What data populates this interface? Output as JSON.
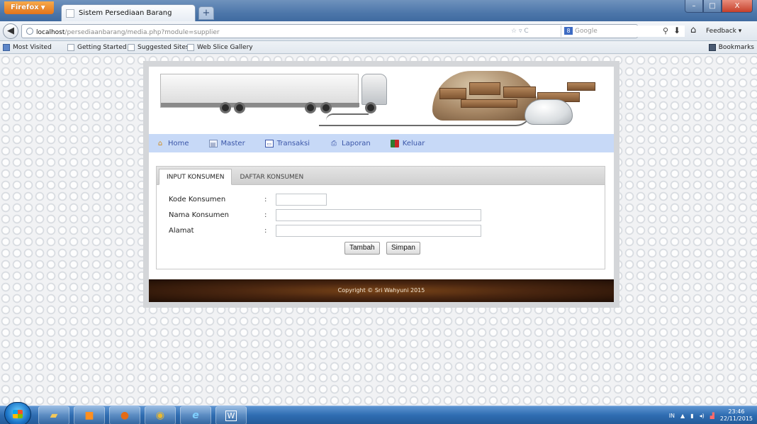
{
  "browser": {
    "app_button": "Firefox",
    "tab_title": "Sistem Persediaan Barang",
    "new_tab": "+",
    "url_host": "localhost",
    "url_path": "/persediaanbarang/media.php?module=supplier",
    "search_placeholder": "Google",
    "feedback_label": "Feedback",
    "window_controls": {
      "minimize": "–",
      "maximize": "□",
      "close": "X"
    }
  },
  "bookmarks": {
    "items": [
      "Most Visited",
      "Getting Started",
      "Suggested Sites",
      "Web Slice Gallery"
    ],
    "bookmarks_label": "Bookmarks"
  },
  "menu": {
    "items": [
      {
        "label": "Home",
        "icon": "home-icon"
      },
      {
        "label": "Master",
        "icon": "master-icon"
      },
      {
        "label": "Transaksi",
        "icon": "transaksi-icon"
      },
      {
        "label": "Laporan",
        "icon": "printer-icon"
      },
      {
        "label": "Keluar",
        "icon": "exit-icon"
      }
    ]
  },
  "tabs": [
    {
      "label": "INPUT KONSUMEN",
      "active": true
    },
    {
      "label": "DAFTAR KONSUMEN",
      "active": false
    }
  ],
  "form": {
    "fields": [
      {
        "label": "Kode Konsumen",
        "value": ""
      },
      {
        "label": "Nama Konsumen",
        "value": ""
      },
      {
        "label": "Alamat",
        "value": ""
      }
    ],
    "colon": ":",
    "buttons": {
      "add": "Tambah",
      "save": "Simpan"
    }
  },
  "footer": {
    "copyright": "Copyright © Sri Wahyuni 2015"
  },
  "taskbar": {
    "lang": "IN",
    "time": "23:46",
    "date": "22/11/2015"
  }
}
